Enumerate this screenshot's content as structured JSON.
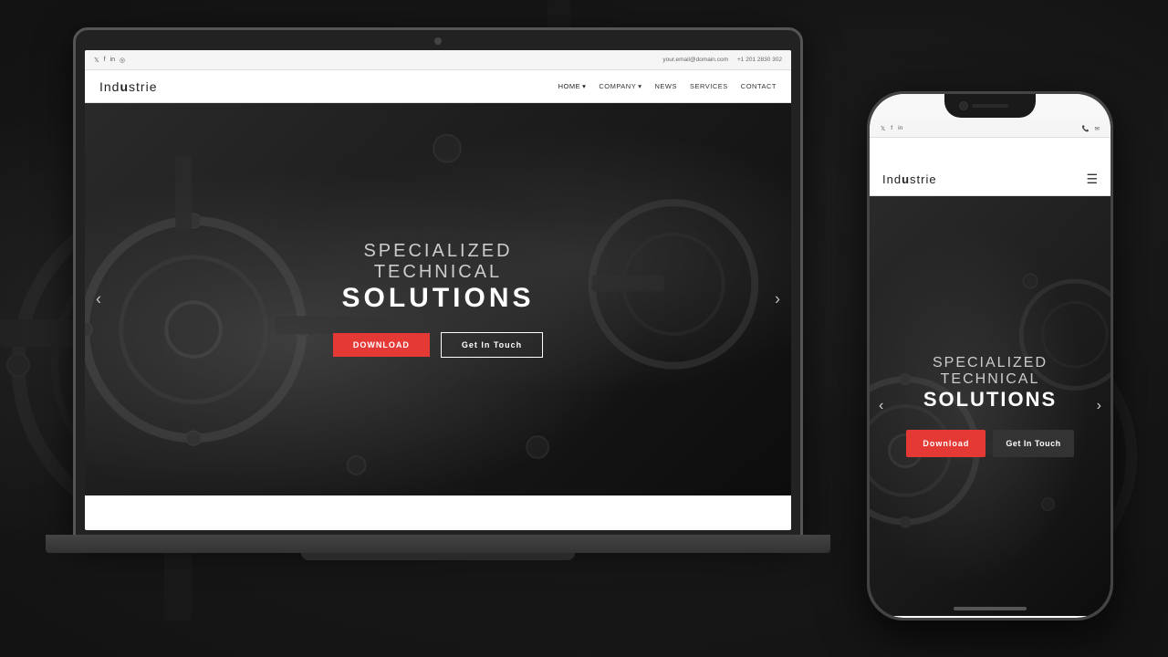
{
  "background": {
    "color": "#1a1a1a"
  },
  "laptop": {
    "website": {
      "topbar": {
        "email": "your.email@domain.com",
        "phone": "+1 201 2830 302",
        "social_icons": [
          "tw",
          "fb",
          "in",
          "ig"
        ]
      },
      "navbar": {
        "logo": "Industrie",
        "nav_items": [
          {
            "label": "HOME",
            "has_dropdown": true,
            "active": true
          },
          {
            "label": "COMPANY",
            "has_dropdown": true
          },
          {
            "label": "NEWS"
          },
          {
            "label": "SERVICES"
          },
          {
            "label": "CONTACT"
          }
        ]
      },
      "hero": {
        "subtitle_line1": "SPECIALIZED",
        "subtitle_line2": "TECHNICAL",
        "title_main": "SOLUTIONS",
        "btn_download": "Download",
        "btn_touch": "Get In Touch",
        "arrow_left": "‹",
        "arrow_right": "›"
      }
    }
  },
  "phone": {
    "website": {
      "statusbar": {
        "social_icons": [
          "tw",
          "fb",
          "in"
        ],
        "phone_icon": "📞",
        "mail_icon": "✉"
      },
      "navbar": {
        "logo": "Industrie",
        "menu_icon": "☰"
      },
      "hero": {
        "subtitle_line1": "SPECIALIZED",
        "subtitle_line2": "TECHNICAL",
        "title_main": "SOLUTIONS",
        "btn_download": "Download",
        "btn_touch": "Get In Touch",
        "arrow_left": "‹",
        "arrow_right": "›"
      }
    }
  }
}
